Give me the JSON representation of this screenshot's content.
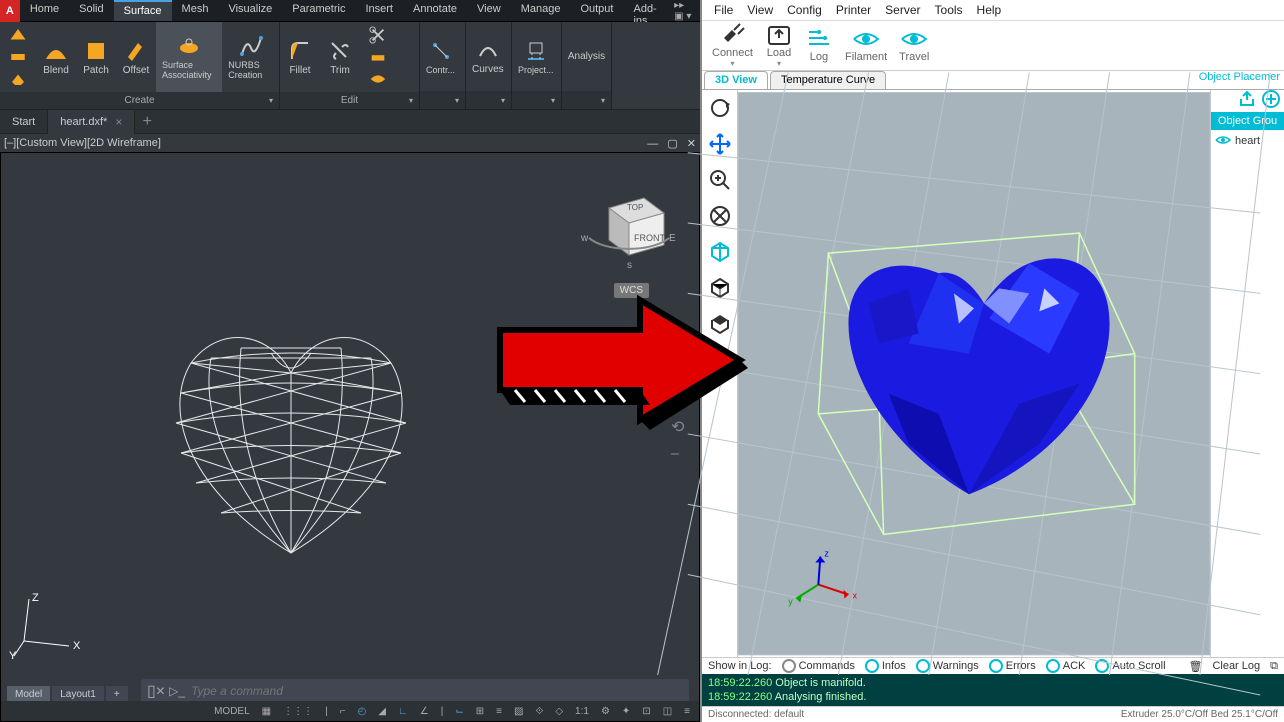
{
  "cad": {
    "menu": [
      "Home",
      "Solid",
      "Surface",
      "Mesh",
      "Visualize",
      "Parametric",
      "Insert",
      "Annotate",
      "View",
      "Manage",
      "Output",
      "Add-ins"
    ],
    "active_menu": "Surface",
    "ribbon": {
      "create": {
        "label": "Create",
        "sidecol": [
          "Loft",
          "Sweep",
          "Extrude"
        ],
        "buttons": [
          {
            "label": "Blend"
          },
          {
            "label": "Patch"
          },
          {
            "label": "Offset"
          },
          {
            "label": "Surface Associativity",
            "active": true
          },
          {
            "label": "NURBS Creation"
          }
        ]
      },
      "edit": {
        "label": "Edit",
        "buttons": [
          {
            "label": "Fillet"
          },
          {
            "label": "Trim"
          },
          {
            "label": ""
          }
        ]
      },
      "other": [
        {
          "label": "Contr..."
        },
        {
          "label": "Curves"
        },
        {
          "label": "Project..."
        },
        {
          "label": "Analysis"
        }
      ]
    },
    "file_tabs": [
      {
        "label": "Start",
        "active": false
      },
      {
        "label": "heart.dxf*",
        "active": true
      }
    ],
    "viewport_label": "[–][Custom View][2D Wireframe]",
    "wcs": "WCS",
    "viewcube": {
      "top": "TOP",
      "front": "FRONT",
      "w": "w",
      "s": "s",
      "e": "E"
    },
    "ucs_axes": {
      "x": "X",
      "y": "Y",
      "z": "Z"
    },
    "cmd_placeholder": "Type a command",
    "model_tabs": [
      "Model",
      "Layout1"
    ],
    "status_model": "MODEL",
    "status_scale": "1:1"
  },
  "slicer": {
    "menu": [
      "File",
      "View",
      "Config",
      "Printer",
      "Server",
      "Tools",
      "Help"
    ],
    "toolbar": [
      {
        "name": "Connect",
        "kind": "connect"
      },
      {
        "name": "Load",
        "kind": "load"
      },
      {
        "name": "Log",
        "kind": "log"
      },
      {
        "name": "Filament",
        "kind": "eye"
      },
      {
        "name": "Travel",
        "kind": "eye"
      }
    ],
    "view_tabs": [
      {
        "label": "3D View",
        "active": true
      },
      {
        "label": "Temperature Curve",
        "active": false
      }
    ],
    "right_panel": {
      "header": "Object Placemer",
      "title": "Object Grou",
      "items": [
        "heart"
      ]
    },
    "log_filter": {
      "label": "Show in Log:",
      "items": [
        "Commands",
        "Infos",
        "Warnings",
        "Errors",
        "ACK",
        "Auto Scroll"
      ],
      "clear": "Clear Log"
    },
    "log_lines": [
      {
        "ts": "18:59:22.260",
        "msg": "Object is manifold."
      },
      {
        "ts": "18:59:22.260",
        "msg": "Analysing finished."
      }
    ],
    "status_left": "Disconnected: default",
    "status_right": "Extruder 25.0°C/Off Bed 25.1°C/Off"
  }
}
